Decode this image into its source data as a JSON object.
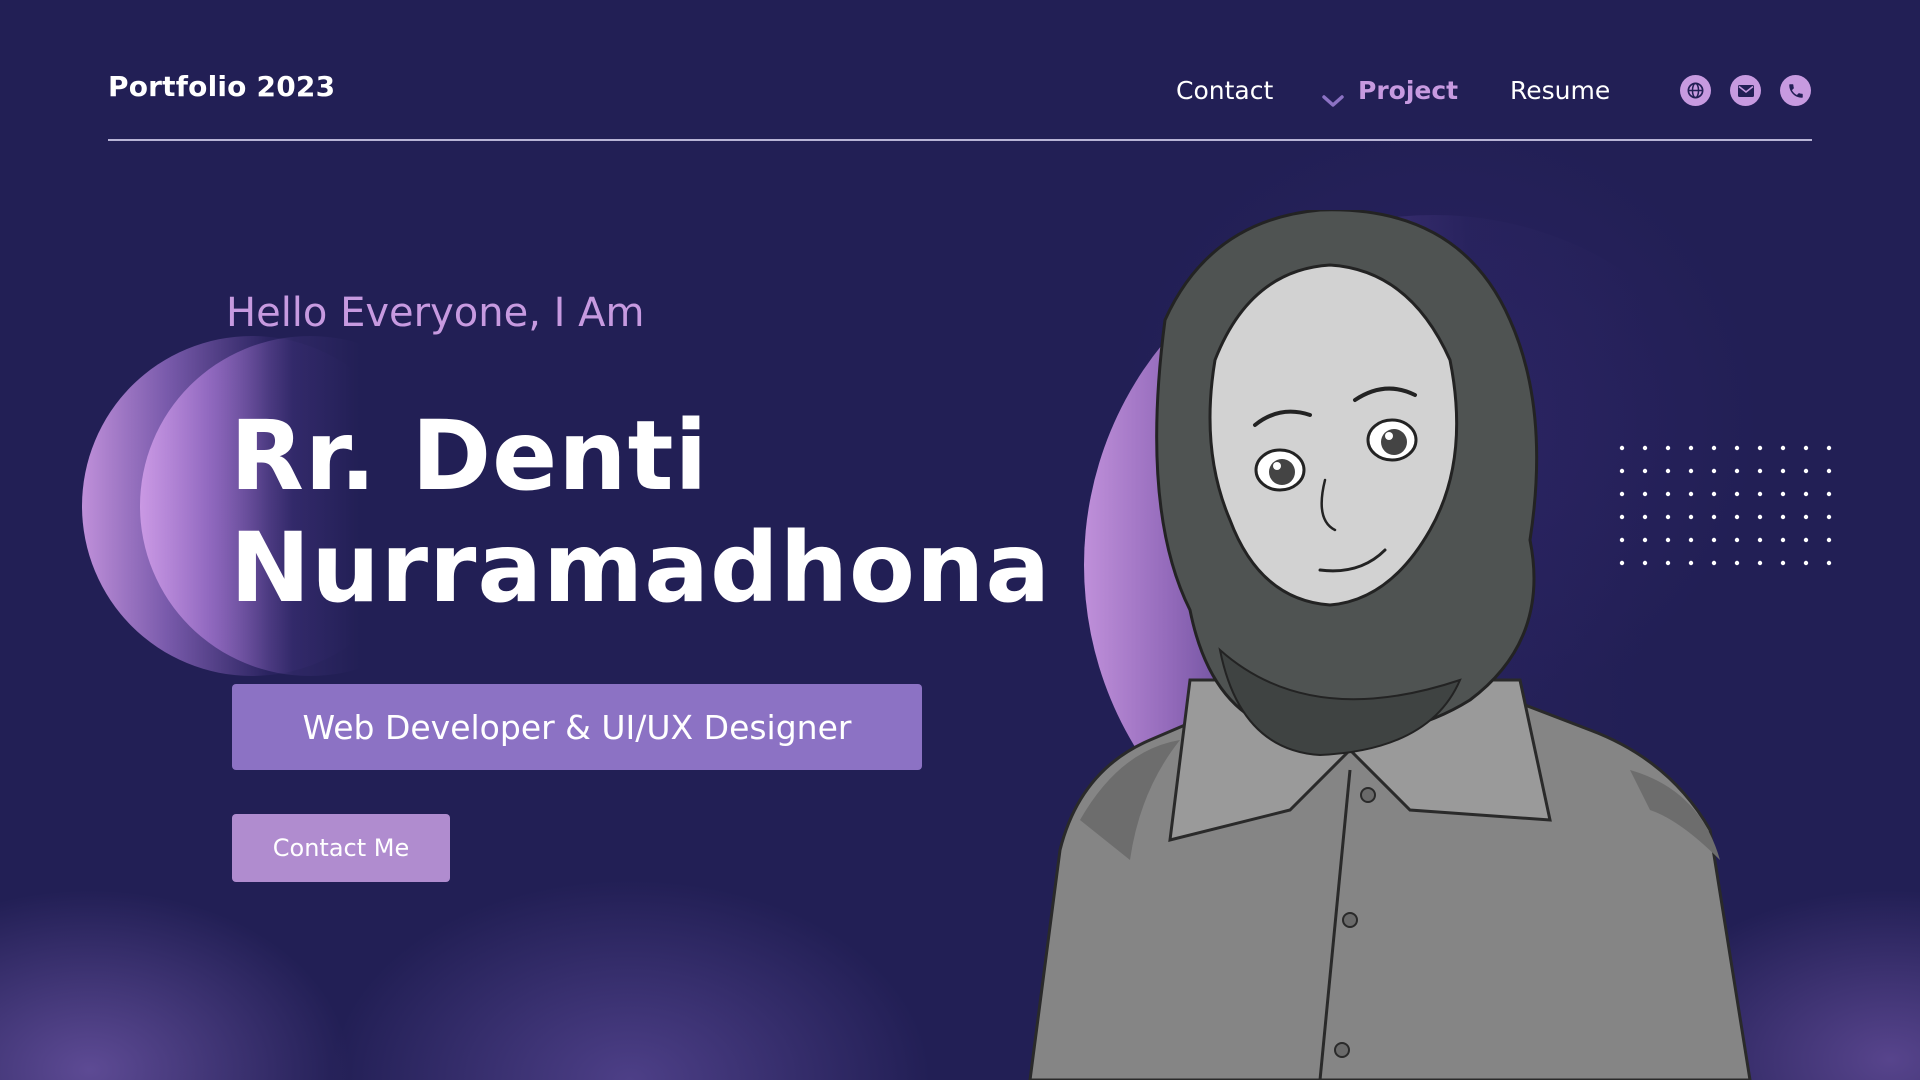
{
  "header": {
    "brand": "Portfolio 2023",
    "nav": [
      {
        "label": "Contact",
        "active": false
      },
      {
        "label": "Project",
        "active": true
      },
      {
        "label": "Resume",
        "active": false
      }
    ],
    "icons": [
      "globe-icon",
      "mail-icon",
      "phone-icon"
    ]
  },
  "hero": {
    "greeting": "Hello Everyone, I Am",
    "name_line1": "Rr. Denti",
    "name_line2": "Nurramadhona",
    "role": "Web Developer & UI/UX Designer",
    "cta": "Contact Me"
  },
  "colors": {
    "background": "#221f55",
    "accent": "#c79ae0",
    "role_button": "#8c72c4",
    "cta_button": "#b08ccf"
  }
}
